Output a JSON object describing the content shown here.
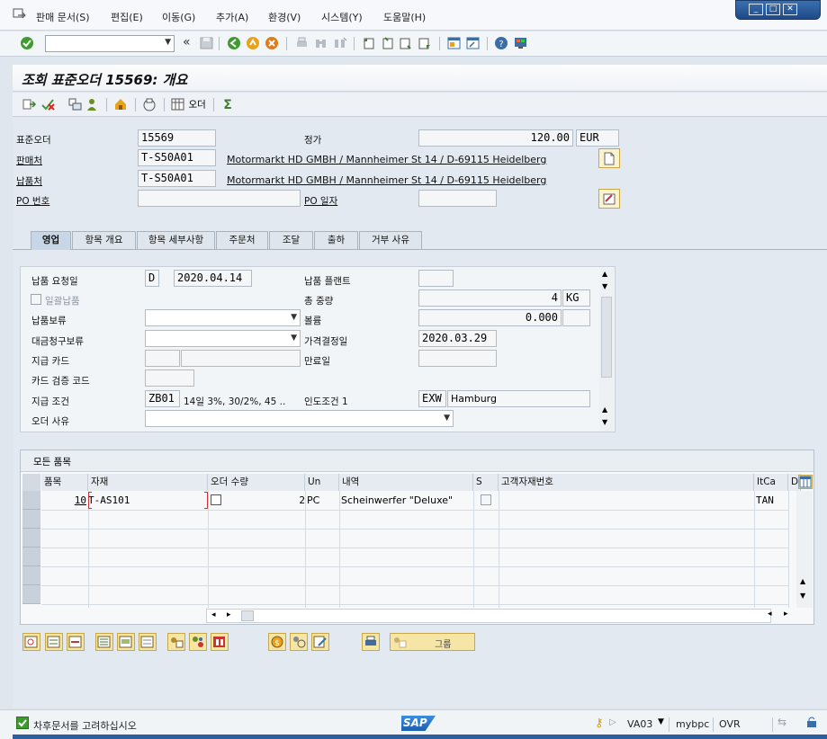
{
  "menu": {
    "items": [
      "판매 문서(S)",
      "편집(E)",
      "이동(G)",
      "추가(A)",
      "환경(V)",
      "시스템(Y)",
      "도움말(H)"
    ]
  },
  "window_controls": [
    "minimize-icon",
    "maximize-icon",
    "close-icon"
  ],
  "toolbar": {
    "command_field": {
      "value": "",
      "placeholder": ""
    },
    "back_chevrons": "«"
  },
  "title": "조회 표준오더 15569: 개요",
  "app_toolbar": {
    "order_button_label": "오더"
  },
  "header": {
    "standard_order_label": "표준오더",
    "standard_order_value": "15569",
    "net_value_label": "정가",
    "net_value": "120.00",
    "currency": "EUR",
    "sold_to_label": "판매처",
    "sold_to_value": "T-S50A01",
    "sold_to_address": "Motormarkt HD GMBH / Mannheimer St 14 / D-69115 Heidelberg",
    "ship_to_label": "납품처",
    "ship_to_value": "T-S50A01",
    "ship_to_address": "Motormarkt HD GMBH / Mannheimer St 14 / D-69115 Heidelberg",
    "po_number_label": "PO 번호",
    "po_number_value": "",
    "po_date_label": "PO 일자",
    "po_date_value": ""
  },
  "tabs": [
    "영업",
    "항목 개요",
    "항목 세부사항",
    "주문처",
    "조달",
    "출하",
    "거부 사유"
  ],
  "active_tab": "영업",
  "sales": {
    "req_delivery_date_label": "납품 요청일",
    "req_delivery_date_type": "D",
    "req_delivery_date": "2020.04.14",
    "delivery_plant_label": "납품 플랜트",
    "delivery_plant": "",
    "complete_delivery_label": "일괄납품",
    "total_weight_label": "총 중량",
    "total_weight": "4",
    "weight_unit": "KG",
    "delivery_block_label": "납품보류",
    "volume_label": "볼륨",
    "volume": "0.000",
    "volume_unit": "",
    "billing_block_label": "대금청구보류",
    "pricing_date_label": "가격결정일",
    "pricing_date": "2020.03.29",
    "payment_card_label": "지급 카드",
    "expiry_label": "만료일",
    "card_verification_label": "카드 검증 코드",
    "payment_terms_label": "지급 조건",
    "payment_terms_code": "ZB01",
    "payment_terms_text": "14일 3%, 30/2%, 45 ..",
    "incoterms_label": "인도조건 1",
    "incoterms_code": "EXW",
    "incoterms_place": "Hamburg",
    "order_reason_label": "오더 사유"
  },
  "items_table": {
    "title": "모든 품목",
    "columns": [
      "품목",
      "자재",
      "오더 수량",
      "Un",
      "내역",
      "S",
      "고객자재번호",
      "ItCa",
      "D"
    ],
    "rows": [
      {
        "item": "10",
        "material": "T-AS101",
        "qty": "2",
        "unit": "PC",
        "description": "Scheinwerfer \"Deluxe\"",
        "customer_material": "",
        "item_category": "TAN"
      }
    ]
  },
  "bottom_buttons": {
    "group_label": "그룹"
  },
  "status": {
    "message": "차후문서를 고려하십시오",
    "transaction": "VA03",
    "server": "mybpc",
    "mode": "OVR",
    "logo": "SAP"
  },
  "colors": {
    "accent_blue": "#2c5fa0",
    "button_yellow": "#f6e6a5",
    "green_check": "#3f9b2f",
    "orange": "#e07b1a"
  }
}
